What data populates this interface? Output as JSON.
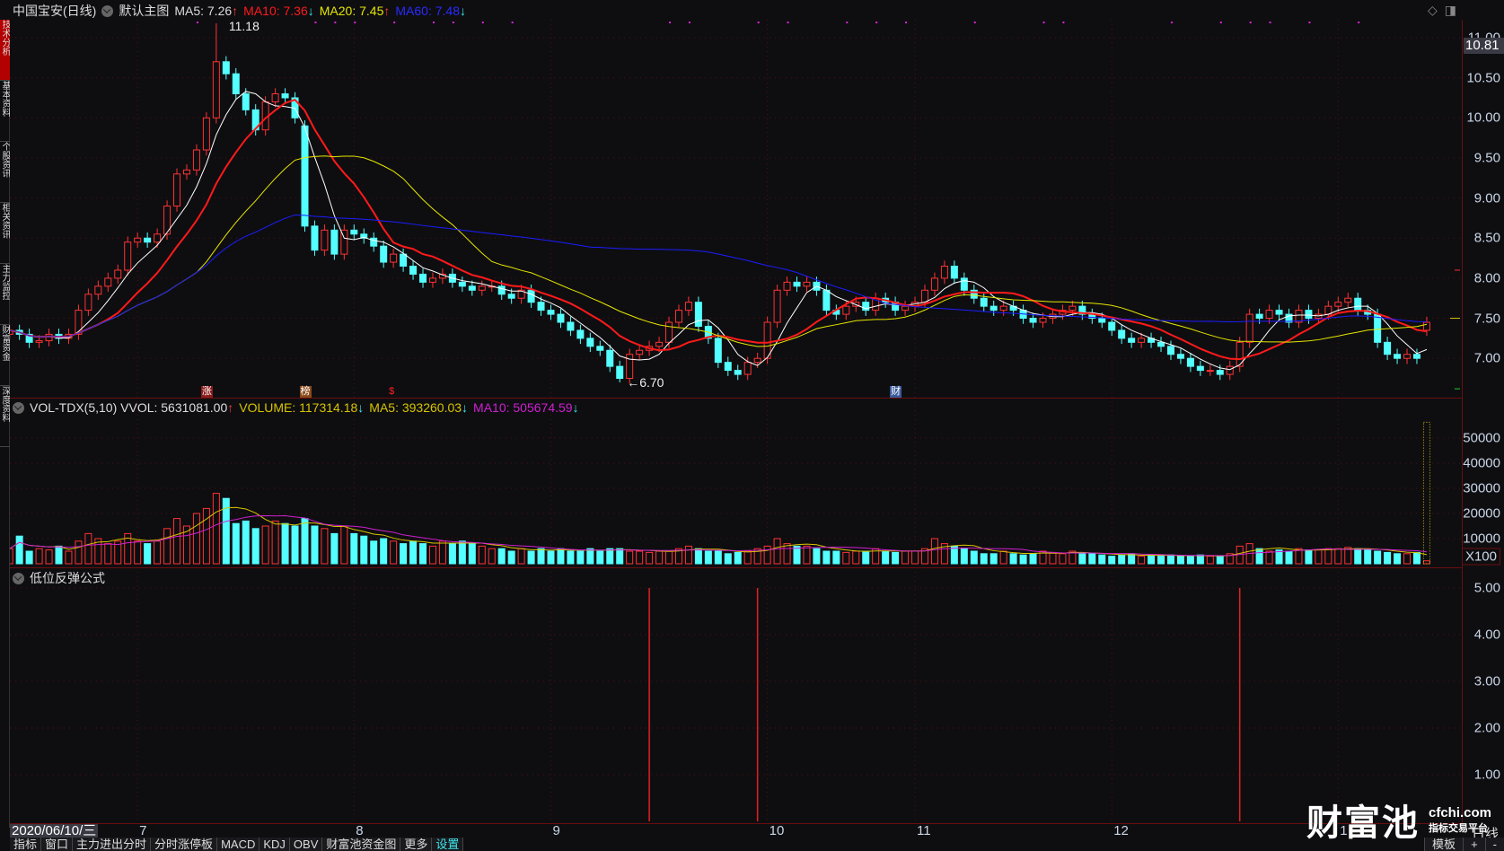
{
  "header": {
    "title": "中国宝安(日线)",
    "template": "默认主图",
    "ma5": "MA5: 7.26",
    "ma5_arrow": "↑",
    "ma10": "MA10: 7.36",
    "ma10_arrow": "↓",
    "ma20": "MA20: 7.45",
    "ma20_arrow": "↑",
    "ma60": "MA60: 7.48",
    "ma60_arrow": "↓"
  },
  "header_icons": [
    "diamond-icon",
    "panel-toggle-icon"
  ],
  "sidebar": [
    "技术分析",
    "基本资料",
    "个股资讯",
    "相关资讯",
    "主力监控",
    "财富资金",
    "深度资料"
  ],
  "price_readout": "10.81",
  "volume_header": {
    "name": "VOL-TDX(5,10)",
    "vvol": "VVOL: 5631081.00",
    "vvol_arrow": "↑",
    "volume": "VOLUME: 117314.18",
    "volume_arrow": "↓",
    "ma5": "MA5: 393260.03",
    "ma5_arrow": "↓",
    "ma10": "MA10: 505674.59",
    "ma10_arrow": "↓"
  },
  "indicator_header": {
    "name": "低位反弹公式"
  },
  "event_markers": [
    {
      "label": "涨",
      "index": 20,
      "color": "#8b1a1a"
    },
    {
      "label": "榜",
      "index": 30,
      "color": "#8b4a1a"
    },
    {
      "label": "$",
      "index": 39,
      "color": "#ff2020"
    },
    {
      "label": "财",
      "index": 90,
      "color": "#3a5a9a"
    }
  ],
  "date_axis": {
    "cursor_date": "2020/06/10/三",
    "period": "日线"
  },
  "bottom_tabs": [
    "指标",
    "窗口",
    "主力进出分时",
    "分时涨停板",
    "MACD",
    "KDJ",
    "OBV",
    "财富池资金图",
    "更多",
    "设置"
  ],
  "bottom_right": [
    "模板",
    "+",
    "-"
  ],
  "watermark": {
    "name": "财富池",
    "site": "cfchi.com",
    "slogan": "指标交易平台"
  },
  "colors": {
    "up": "#ff3232",
    "down": "#54ffff",
    "ma5": "#ffffff",
    "ma10": "#ff1a1a",
    "ma20": "#e6e600",
    "ma60": "#1c1cff",
    "vma5": "#d8c400",
    "vma10": "#d020d0",
    "grid": "#5a0c0c"
  },
  "chart_data": [
    {
      "type": "candlestick",
      "title": "中国宝安(日线)",
      "ylim": [
        6.6,
        11.2
      ],
      "yticks": [
        "11.00",
        "10.50",
        "10.00",
        "9.50",
        "9.00",
        "8.50",
        "8.00",
        "7.50",
        "7.00"
      ],
      "months": [
        {
          "label": "7",
          "index": 13
        },
        {
          "label": "8",
          "index": 35
        },
        {
          "label": "9",
          "index": 55
        },
        {
          "label": "10",
          "index": 77
        },
        {
          "label": "11",
          "index": 92
        },
        {
          "label": "12",
          "index": 112
        },
        {
          "label": "1",
          "index": 135
        }
      ],
      "annotations": [
        {
          "text": "11.18",
          "index": 21,
          "value": 11.18,
          "kind": "high"
        },
        {
          "text": "6.70",
          "index": 62,
          "value": 6.7,
          "kind": "low"
        }
      ],
      "open": [
        7.3,
        7.35,
        7.3,
        7.2,
        7.22,
        7.3,
        7.25,
        7.3,
        7.6,
        7.8,
        7.9,
        8.0,
        8.1,
        8.45,
        8.5,
        8.45,
        8.55,
        8.9,
        9.3,
        9.35,
        9.6,
        10.0,
        10.7,
        10.55,
        10.3,
        10.1,
        9.85,
        10.2,
        10.3,
        10.25,
        9.9,
        8.65,
        8.35,
        8.6,
        8.3,
        8.6,
        8.55,
        8.5,
        8.4,
        8.2,
        8.3,
        8.15,
        8.05,
        7.95,
        8.0,
        8.05,
        7.95,
        7.9,
        7.85,
        7.9,
        7.9,
        7.8,
        7.75,
        7.85,
        7.7,
        7.6,
        7.55,
        7.45,
        7.35,
        7.25,
        7.15,
        7.1,
        6.9,
        6.75,
        7.05,
        7.1,
        7.15,
        7.2,
        7.45,
        7.6,
        7.7,
        7.4,
        7.25,
        6.95,
        6.85,
        6.8,
        6.95,
        7.0,
        7.45,
        7.85,
        7.95,
        7.9,
        7.95,
        7.85,
        7.6,
        7.55,
        7.65,
        7.7,
        7.6,
        7.75,
        7.7,
        7.6,
        7.65,
        7.7,
        7.85,
        8.0,
        8.15,
        8.0,
        7.85,
        7.75,
        7.65,
        7.6,
        7.65,
        7.6,
        7.5,
        7.45,
        7.5,
        7.55,
        7.6,
        7.65,
        7.55,
        7.5,
        7.45,
        7.35,
        7.25,
        7.2,
        7.25,
        7.2,
        7.15,
        7.05,
        7.0,
        6.9,
        6.85,
        6.85,
        6.8,
        6.9,
        7.2,
        7.55,
        7.5,
        7.6,
        7.55,
        7.45,
        7.6,
        7.5,
        7.55,
        7.65,
        7.7,
        7.75,
        7.6,
        7.55,
        7.2,
        7.05,
        7.0,
        7.05,
        7.35
      ],
      "close": [
        7.35,
        7.3,
        7.2,
        7.22,
        7.3,
        7.25,
        7.3,
        7.6,
        7.8,
        7.9,
        8.0,
        8.1,
        8.45,
        8.5,
        8.45,
        8.55,
        8.9,
        9.3,
        9.35,
        9.6,
        10.0,
        10.7,
        10.55,
        10.3,
        10.1,
        9.85,
        10.2,
        10.3,
        10.25,
        10.0,
        8.65,
        8.35,
        8.6,
        8.3,
        8.6,
        8.55,
        8.5,
        8.4,
        8.2,
        8.3,
        8.15,
        8.05,
        7.95,
        8.0,
        8.05,
        7.95,
        7.9,
        7.85,
        7.9,
        7.9,
        7.8,
        7.75,
        7.85,
        7.7,
        7.6,
        7.55,
        7.45,
        7.35,
        7.25,
        7.15,
        7.1,
        6.9,
        6.75,
        7.05,
        7.1,
        7.15,
        7.2,
        7.45,
        7.6,
        7.7,
        7.4,
        7.25,
        6.95,
        6.85,
        6.8,
        6.95,
        7.0,
        7.45,
        7.85,
        7.95,
        7.9,
        7.95,
        7.85,
        7.6,
        7.55,
        7.65,
        7.7,
        7.6,
        7.75,
        7.7,
        7.6,
        7.65,
        7.7,
        7.85,
        8.0,
        8.15,
        8.0,
        7.85,
        7.75,
        7.65,
        7.6,
        7.65,
        7.6,
        7.5,
        7.45,
        7.5,
        7.55,
        7.6,
        7.65,
        7.55,
        7.5,
        7.45,
        7.35,
        7.25,
        7.2,
        7.25,
        7.2,
        7.15,
        7.05,
        7.0,
        6.9,
        6.85,
        6.85,
        6.8,
        6.9,
        7.2,
        7.55,
        7.5,
        7.6,
        7.55,
        7.45,
        7.6,
        7.5,
        7.55,
        7.65,
        7.7,
        7.75,
        7.6,
        7.55,
        7.2,
        7.05,
        7.0,
        7.05,
        7.0,
        7.45
      ],
      "ma_periods": [
        5,
        10,
        20,
        60
      ]
    },
    {
      "type": "bar",
      "title": "VOL-TDX(5,10)",
      "unit": "X100",
      "ylim": [
        0,
        60000
      ],
      "yticks": [
        "50000",
        "40000",
        "30000",
        "20000",
        "10000"
      ],
      "values": [
        6000,
        11000,
        5000,
        6000,
        5500,
        7000,
        5000,
        9000,
        12000,
        10000,
        8000,
        9000,
        12000,
        9000,
        8000,
        9000,
        14000,
        18000,
        15000,
        20000,
        22000,
        28000,
        26000,
        16000,
        17000,
        14000,
        15000,
        17000,
        16000,
        15000,
        18000,
        15000,
        14000,
        12000,
        15000,
        12000,
        11000,
        9000,
        10000,
        9000,
        8000,
        9000,
        8000,
        7000,
        9000,
        8000,
        9000,
        8000,
        7000,
        6000,
        6000,
        5000,
        6000,
        5000,
        6000,
        5000,
        6000,
        5000,
        5000,
        6000,
        5000,
        6000,
        6000,
        5000,
        5000,
        4500,
        5000,
        5000,
        6000,
        7000,
        6000,
        5000,
        5000,
        4000,
        4500,
        5000,
        6000,
        7000,
        10000,
        8000,
        7000,
        7000,
        6000,
        5000,
        5000,
        4500,
        5000,
        5000,
        6000,
        5000,
        4500,
        5000,
        5000,
        6000,
        10000,
        8000,
        7000,
        6000,
        5000,
        4000,
        4000,
        5000,
        4000,
        3500,
        4000,
        5000,
        4500,
        4000,
        5000,
        4000,
        4000,
        3500,
        3000,
        3500,
        4000,
        3000,
        3500,
        3000,
        3500,
        3000,
        3000,
        3500,
        3000,
        3000,
        4000,
        7000,
        8000,
        6000,
        5000,
        5500,
        5000,
        6000,
        5500,
        5500,
        6000,
        6000,
        6500,
        6000,
        5500,
        5000,
        4500,
        4000,
        4000,
        4500,
        1173
      ],
      "virtual_last": 56310.81,
      "ma_periods": [
        5,
        10
      ]
    },
    {
      "type": "bar",
      "title": "低位反弹公式",
      "ylim": [
        0,
        5.5
      ],
      "yticks": [
        "5.00",
        "4.00",
        "3.00",
        "2.00",
        "1.00"
      ],
      "signals": [
        {
          "index": 65,
          "value": 5
        },
        {
          "index": 76,
          "value": 5
        },
        {
          "index": 125,
          "value": 5
        }
      ]
    }
  ]
}
